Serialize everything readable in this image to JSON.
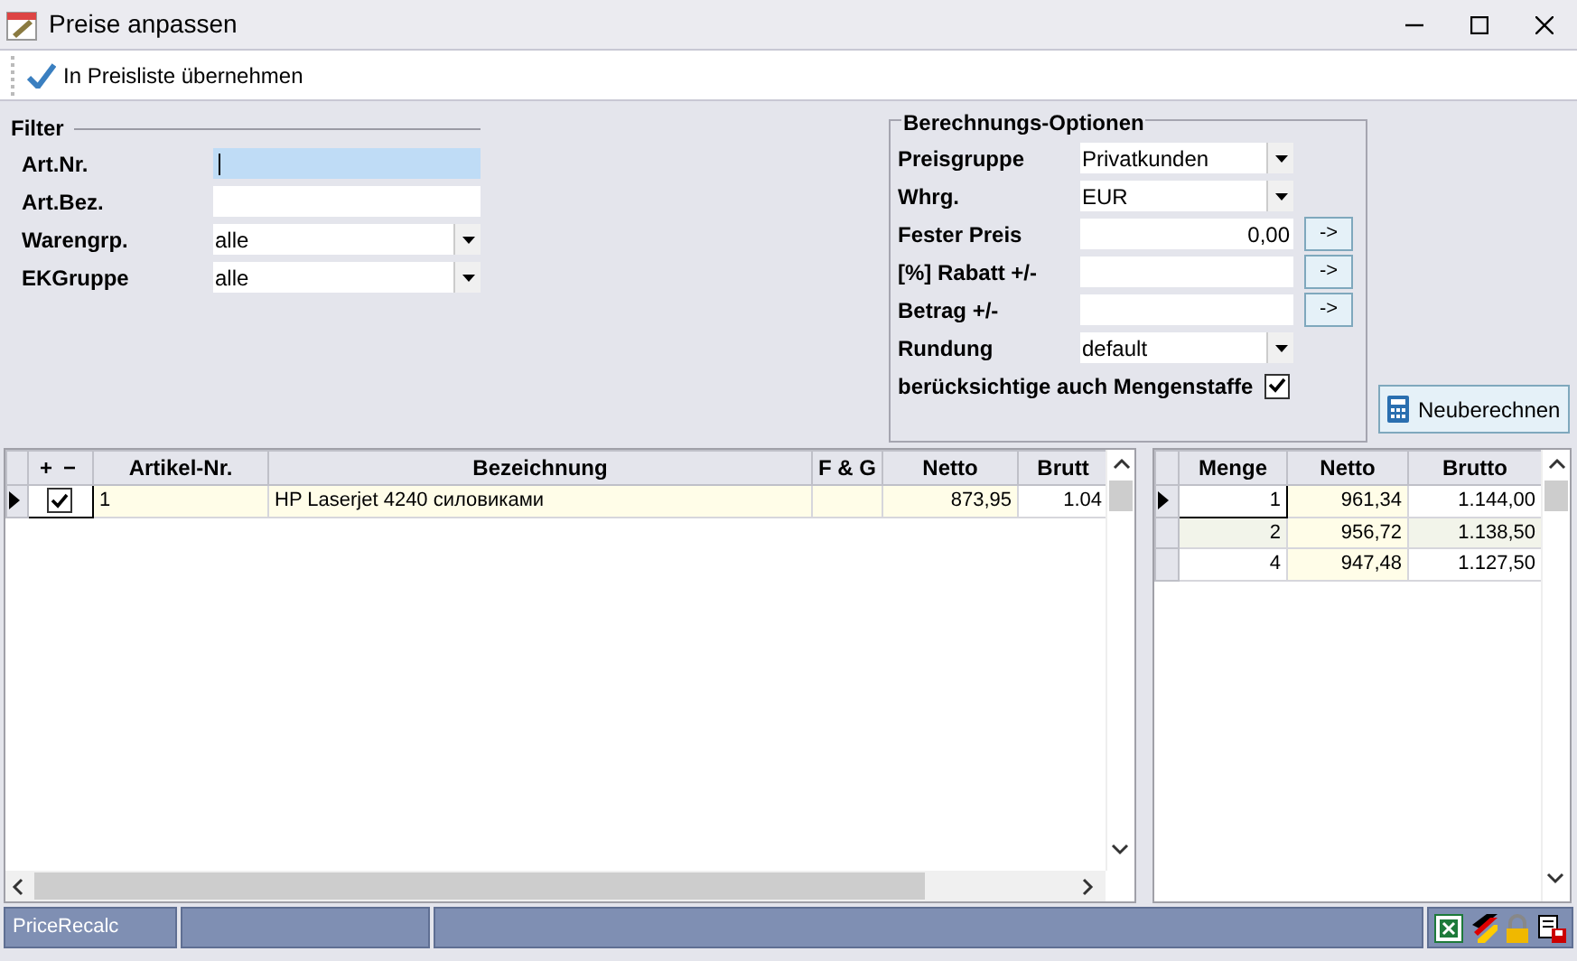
{
  "window": {
    "title": "Preise anpassen"
  },
  "toolbar": {
    "buttons": [
      {
        "label": "In Preisliste übernehmen"
      }
    ]
  },
  "filter": {
    "title": "Filter",
    "fields": [
      {
        "label": "Art.Nr.",
        "kind": "text",
        "focused": true
      },
      {
        "label": "Art.Bez.",
        "kind": "text",
        "focused": false
      },
      {
        "label": "Warengrp.",
        "kind": "select",
        "value": "alle",
        "focused": false
      },
      {
        "label": "EKGruppe",
        "kind": "select",
        "value": "alle",
        "focused": false
      }
    ]
  },
  "options": {
    "title": "Berechnungs-Optionen",
    "fields": [
      {
        "label": "Preisgruppe",
        "kind": "select",
        "value": "Privatkunden"
      },
      {
        "label": "Whrg.",
        "kind": "select",
        "value": "EUR"
      },
      {
        "label": "Fester Preis",
        "kind": "text",
        "value": "0,00",
        "apply": "->"
      },
      {
        "label": "[%] Rabatt +/-",
        "kind": "text",
        "apply": "->"
      },
      {
        "label": "Betrag +/-",
        "kind": "text",
        "apply": "->"
      },
      {
        "label": "Rundung",
        "kind": "select",
        "value": "default"
      },
      {
        "label": "berücksichtige auch Mengenstaffe",
        "kind": "checkbox",
        "checked": true
      }
    ]
  },
  "recalc_button": {
    "label": "Neuberechnen"
  },
  "articles": {
    "add": "+",
    "remove": "−",
    "columns": [
      "Artikel-Nr.",
      "Bezeichnung",
      "F & G",
      "Netto",
      "Brutt"
    ],
    "rows": [
      {
        "current": true,
        "checked": true,
        "cells": [
          "1",
          "HP Laserjet 4240 силовиками",
          "",
          "873,95",
          "1.04"
        ]
      }
    ]
  },
  "tiers": {
    "columns": [
      "Menge",
      "Netto",
      "Brutto"
    ],
    "rows": [
      {
        "current": true,
        "cells": [
          "1",
          "961,34",
          "1.144,00"
        ]
      },
      {
        "current": false,
        "cells": [
          "2",
          "956,72",
          "1.138,50"
        ]
      },
      {
        "current": false,
        "cells": [
          "4",
          "947,48",
          "1.127,50"
        ]
      }
    ]
  },
  "status_bar": {
    "panels": [
      "PriceRecalc"
    ]
  }
}
